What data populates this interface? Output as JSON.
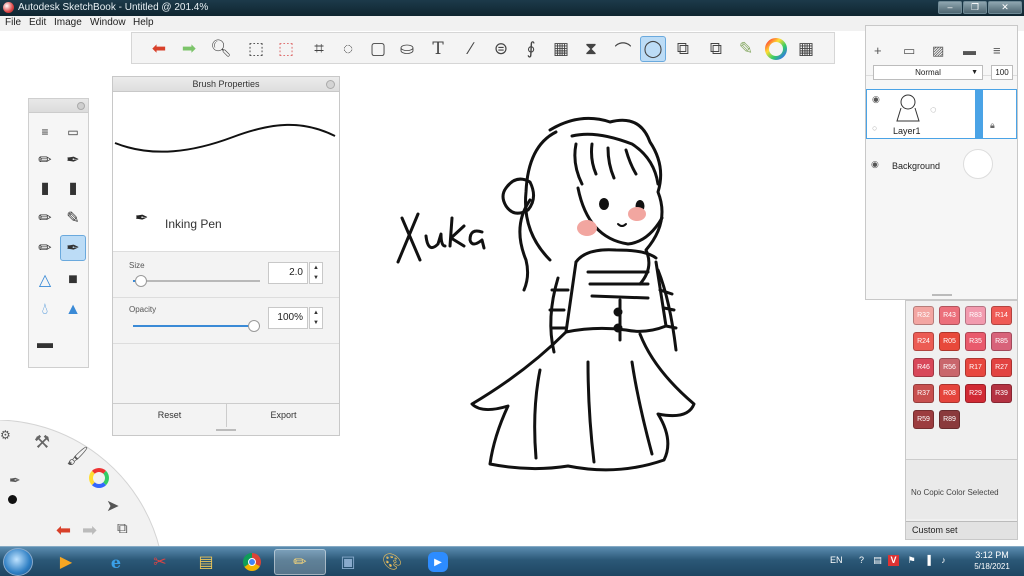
{
  "window": {
    "title": "Autodesk SketchBook - Untitled @ 201.4%"
  },
  "menubar": {
    "items": [
      "File",
      "Edit",
      "Image",
      "Window",
      "Help"
    ]
  },
  "toolbar": {
    "icons": [
      "undo-icon",
      "redo-icon",
      "zoom-icon",
      "select-icon",
      "transform-select-icon",
      "crop-icon",
      "lasso-icon",
      "distort-icon",
      "fill-icon",
      "text-icon",
      "ruler-icon",
      "ellipse-guide-icon",
      "french-curve-icon",
      "perspective-icon",
      "symmetry-icon",
      "stroke-icon",
      "predictive-stroke-icon",
      "shape-icon",
      "layer-editor-icon",
      "brush-library-icon",
      "color-wheel-icon",
      "palette-icon"
    ],
    "active": "predictive-stroke-icon"
  },
  "brush_properties": {
    "title": "Brush Properties",
    "brush_name": "Inking Pen",
    "size": {
      "label": "Size",
      "value": "2.0",
      "fraction": 0.02
    },
    "opacity": {
      "label": "Opacity",
      "value": "100%",
      "fraction": 1.0
    },
    "reset_label": "Reset",
    "export_label": "Export"
  },
  "canvas": {
    "handwriting": "Xuka"
  },
  "layers": {
    "blend_mode": "Normal",
    "opacity": "100",
    "items": [
      {
        "name": "Layer1",
        "selected": true
      },
      {
        "name": "Background",
        "selected": false
      }
    ]
  },
  "copic": {
    "swatches": [
      {
        "label": "R32",
        "color": "#f3a6a2"
      },
      {
        "label": "R43",
        "color": "#ec6f7b"
      },
      {
        "label": "R83",
        "color": "#f29aae"
      },
      {
        "label": "R14",
        "color": "#ef5a55"
      },
      {
        "label": "R24",
        "color": "#ec5c54"
      },
      {
        "label": "R05",
        "color": "#e8493a"
      },
      {
        "label": "R35",
        "color": "#e95a6c"
      },
      {
        "label": "R85",
        "color": "#d8637a"
      },
      {
        "label": "R46",
        "color": "#d8485a"
      },
      {
        "label": "R56",
        "color": "#c9666c"
      },
      {
        "label": "R17",
        "color": "#e8473f"
      },
      {
        "label": "R27",
        "color": "#e24341"
      },
      {
        "label": "R37",
        "color": "#c8504f"
      },
      {
        "label": "R08",
        "color": "#e5443c"
      },
      {
        "label": "R29",
        "color": "#d12a34"
      },
      {
        "label": "R39",
        "color": "#b43242"
      },
      {
        "label": "R59",
        "color": "#9c3c3f"
      },
      {
        "label": "R89",
        "color": "#8a3a3c"
      }
    ],
    "status": "No Copic Color Selected",
    "custom_set": "Custom set"
  },
  "taskbar": {
    "language": "EN",
    "time": "3:12 PM",
    "date": "5/18/2021"
  }
}
